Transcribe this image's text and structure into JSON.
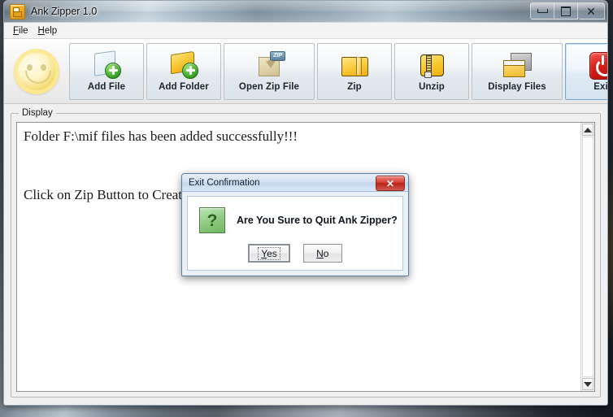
{
  "window": {
    "title": "Ank Zipper 1.0",
    "icon": "zipper-app-icon",
    "controls": {
      "minimize": "minimize-icon",
      "maximize": "maximize-icon",
      "close": "✕"
    }
  },
  "menubar": {
    "items": [
      {
        "label": "File",
        "mnemonic": "F",
        "rest": "ile"
      },
      {
        "label": "Help",
        "mnemonic": "H",
        "rest": "elp"
      }
    ]
  },
  "toolbar": {
    "logo_icon": "smiley-face-icon",
    "buttons": [
      {
        "label": "Add File",
        "icon": "add-file-icon",
        "focused": false
      },
      {
        "label": "Add Folder",
        "icon": "add-folder-icon",
        "focused": false
      },
      {
        "label": "Open Zip File",
        "icon": "open-zip-file-icon",
        "focused": false
      },
      {
        "label": "Zip",
        "icon": "zip-folder-icon",
        "focused": false
      },
      {
        "label": "Unzip",
        "icon": "unzip-icon",
        "focused": false
      },
      {
        "label": "Display Files",
        "icon": "display-files-icon",
        "focused": false
      },
      {
        "label": "Exit",
        "icon": "exit-power-icon",
        "focused": true
      }
    ]
  },
  "display": {
    "legend": "Display",
    "lines": [
      "Folder  F:\\mif files  has been added successfully!!!",
      "Click on Zip Button to Create Zip File with Password Encryption"
    ],
    "scrollbar": {
      "up_arrow": "scroll-up-icon",
      "down_arrow": "scroll-down-icon"
    }
  },
  "dialog": {
    "title": "Exit Confirmation",
    "close_label": "✕",
    "icon": "question-mark-icon",
    "icon_glyph": "?",
    "message": "Are You Sure to Quit Ank Zipper?",
    "buttons": [
      {
        "label": "Yes",
        "mnemonic": "Y",
        "rest": "es",
        "default": true
      },
      {
        "label": "No",
        "mnemonic": "N",
        "rest": "o",
        "default": false
      }
    ]
  },
  "colors": {
    "accent_blue": "#7ba7cf",
    "exit_red": "#d9201a",
    "folder_yellow": "#f9cb3d",
    "question_green": "#8cc97f",
    "dialog_titlebar": "#d4e3f2"
  }
}
